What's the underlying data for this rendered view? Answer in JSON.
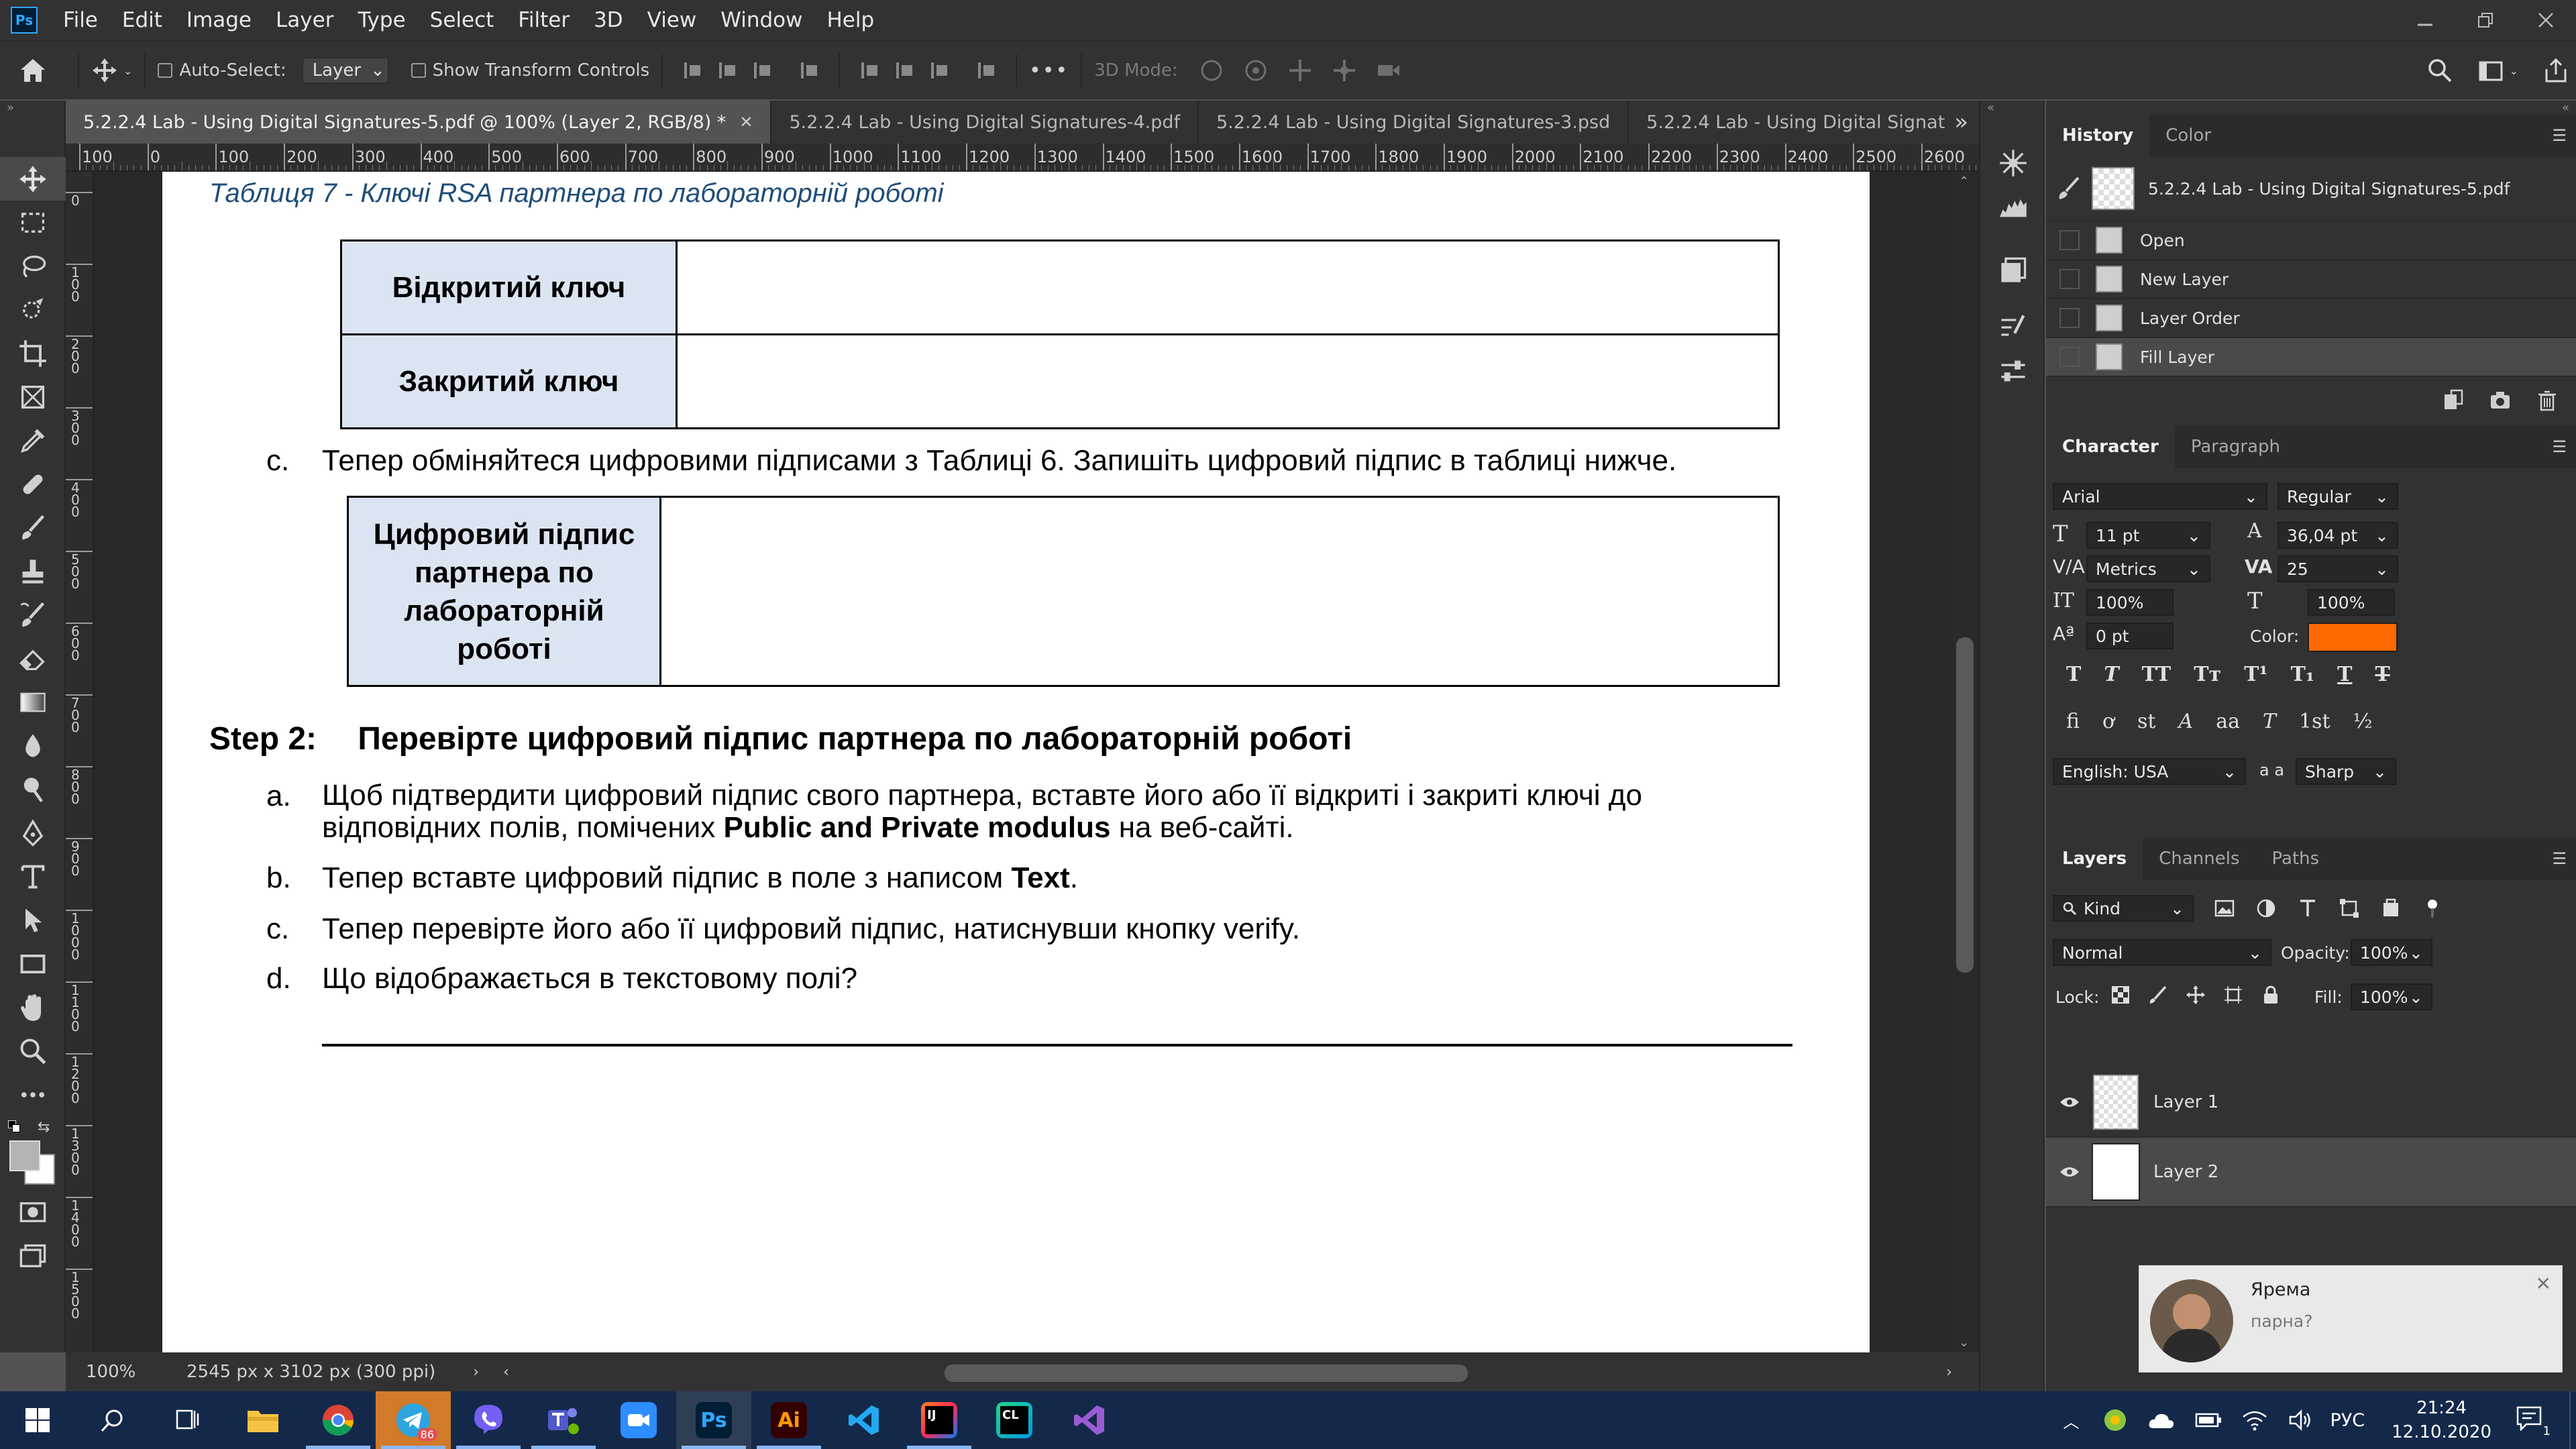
{
  "app": {
    "logo": "Ps",
    "menu": [
      "File",
      "Edit",
      "Image",
      "Layer",
      "Type",
      "Select",
      "Filter",
      "3D",
      "View",
      "Window",
      "Help"
    ]
  },
  "options": {
    "auto_select_label": "Auto-Select:",
    "auto_select_value": "Layer",
    "show_transform_label": "Show Transform Controls",
    "mode_3d_label": "3D Mode:",
    "more": "•••"
  },
  "tabs": [
    {
      "label": "5.2.2.4 Lab - Using Digital Signatures-5.pdf @ 100% (Layer 2, RGB/8) *",
      "active": true
    },
    {
      "label": "5.2.2.4 Lab - Using Digital Signatures-4.pdf"
    },
    {
      "label": "5.2.2.4 Lab - Using Digital Signatures-3.psd"
    },
    {
      "label": "5.2.2.4 Lab - Using Digital Signat"
    }
  ],
  "ruler_h": [
    "100",
    "0",
    "100",
    "200",
    "300",
    "400",
    "500",
    "600",
    "700",
    "800",
    "900",
    "1000",
    "1100",
    "1200",
    "1300",
    "1400",
    "1500",
    "1600",
    "1700",
    "1800",
    "1900",
    "2000",
    "2100",
    "2200",
    "2300",
    "2400",
    "2500",
    "2600"
  ],
  "ruler_v": [
    "0",
    "1 0 0",
    "2 0 0",
    "3 0 0",
    "4 0 0",
    "5 0 0",
    "6 0 0",
    "7 0 0",
    "8 0 0",
    "9 0 0",
    "1 0 0 0",
    "1 1 0 0",
    "1 2 0 0",
    "1 3 0 0",
    "1 4 0 0",
    "1 5 0 0"
  ],
  "document": {
    "caption": "Таблиця 7 - Ключі RSA партнера по лабораторній роботі",
    "keys_table": [
      {
        "label": "Відкритий ключ",
        "value": ""
      },
      {
        "label": "Закритий ключ",
        "value": ""
      }
    ],
    "item_c": {
      "marker": "c.",
      "text": "Тепер обміняйтеся цифровими підписами з Таблиці 6. Запишіть цифровий підпис в таблиці нижче."
    },
    "sig_table": {
      "label": "Цифровий підпис партнера по лабораторній роботі",
      "value": ""
    },
    "step2": {
      "step": "Step 2:",
      "title": "Перевірте цифровий підпис партнера по лабораторній роботі"
    },
    "items": [
      {
        "marker": "a.",
        "text_before": "Щоб підтвердити цифровий підпис свого партнера, вставте його або її відкриті і закриті ключі до відповідних полів, помічених ",
        "bold": "Public and Private modulus",
        "text_after": "  на веб-сайті."
      },
      {
        "marker": "b.",
        "text_before": "Тепер вставте цифровий підпис в поле з написом ",
        "bold": "Text",
        "text_after": "."
      },
      {
        "marker": "c.",
        "text_before": "Тепер перевірте його або її цифровий підпис, натиснувши кнопку verify.",
        "bold": "",
        "text_after": ""
      },
      {
        "marker": "d.",
        "text_before": "Що відображається в текстовому полі?",
        "bold": "",
        "text_after": ""
      }
    ]
  },
  "status": {
    "zoom": "100%",
    "doc_info": "2545 px x 3102 px (300 ppi)"
  },
  "history": {
    "tabs": [
      "History",
      "Color"
    ],
    "snapshot": "5.2.2.4 Lab - Using Digital Signatures-5.pdf",
    "steps": [
      "Open",
      "New Layer",
      "Layer Order",
      "Fill Layer"
    ]
  },
  "character": {
    "tabs": [
      "Character",
      "Paragraph"
    ],
    "font_family": "Arial",
    "font_style": "Regular",
    "size": "11 pt",
    "leading": "36,04 pt",
    "kerning": "Metrics",
    "tracking": "25",
    "vscale": "100%",
    "hscale": "100%",
    "baseline": "0 pt",
    "color_label": "Color:",
    "color": "#ff6a00",
    "language": "English: USA",
    "aa_label": "a a",
    "antialias": "Sharp"
  },
  "layers": {
    "tabs": [
      "Layers",
      "Channels",
      "Paths"
    ],
    "filter": "Kind",
    "blend": "Normal",
    "opacity_label": "Opacity:",
    "opacity": "100%",
    "lock_label": "Lock:",
    "fill_label": "Fill:",
    "fill": "100%",
    "items": [
      {
        "name": "Layer 1",
        "selected": false
      },
      {
        "name": "Layer 2",
        "selected": true
      }
    ]
  },
  "notification": {
    "name": "Ярема",
    "message": "парна?"
  },
  "tray": {
    "lang": "РУС",
    "time": "21:24",
    "date": "12.10.2020",
    "telegram_badge": "86",
    "notif_count": "1"
  }
}
